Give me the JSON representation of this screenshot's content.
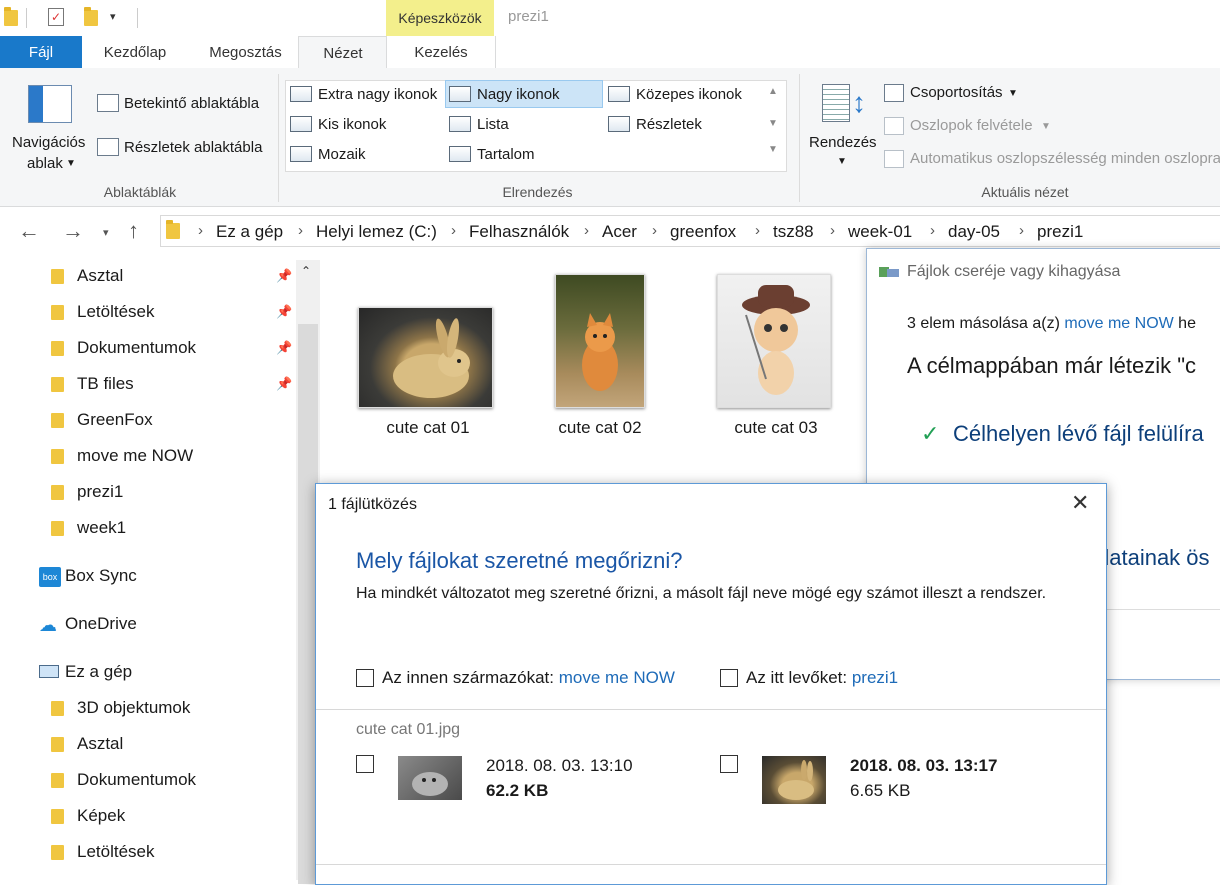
{
  "titlebar": {
    "context_tab": "Képeszközök",
    "window_title": "prezi1"
  },
  "ribbon_tabs": [
    "Fájl",
    "Kezdőlap",
    "Megosztás",
    "Nézet",
    "Kezelés"
  ],
  "panes": {
    "nav_pane_line1": "Navigációs",
    "nav_pane_line2": "ablak",
    "preview_pane": "Betekintő ablaktábla",
    "details_pane": "Részletek ablaktábla",
    "group_label": "Ablaktáblák"
  },
  "layout": {
    "items": [
      "Extra nagy ikonok",
      "Nagy ikonok",
      "Közepes ikonok",
      "Kis ikonok",
      "Lista",
      "Részletek",
      "Mozaik",
      "Tartalom"
    ],
    "selected": "Nagy ikonok",
    "group_label": "Elrendezés"
  },
  "current_view": {
    "sort": "Rendezés",
    "group_by": "Csoportosítás",
    "add_columns": "Oszlopok felvétele",
    "autosize": "Automatikus oszlopszélesség minden oszlopra",
    "group_label": "Aktuális nézet"
  },
  "breadcrumb": [
    "Ez a gép",
    "Helyi lemez (C:)",
    "Felhasználók",
    "Acer",
    "greenfox",
    "tsz88",
    "week-01",
    "day-05",
    "prezi1"
  ],
  "sidebar": {
    "quick_access": [
      {
        "label": "Asztal",
        "pinned": true
      },
      {
        "label": "Letöltések",
        "pinned": true
      },
      {
        "label": "Dokumentumok",
        "pinned": true
      },
      {
        "label": "TB files",
        "pinned": true
      },
      {
        "label": "GreenFox",
        "pinned": false
      },
      {
        "label": "move me NOW",
        "pinned": false
      },
      {
        "label": "prezi1",
        "pinned": false
      },
      {
        "label": "week1",
        "pinned": false
      }
    ],
    "box_sync": "Box Sync",
    "onedrive": "OneDrive",
    "this_pc": "Ez a gép",
    "pc_items": [
      "3D objektumok",
      "Asztal",
      "Dokumentumok",
      "Képek",
      "Letöltések"
    ]
  },
  "files": [
    "cute cat 01",
    "cute cat 02",
    "cute cat 03"
  ],
  "progress_dialog": {
    "title": "Fájlok cseréje vagy kihagyása",
    "copy_prefix": "3 elem másolása a(z) ",
    "copy_source": "move me NOW",
    "copy_suffix": " he",
    "exists_text": "A célmappában már létezik \"c",
    "replace_option": "Célhelyen lévő fájl felülíra",
    "compare_partial": "datainak ös"
  },
  "conflict_dialog": {
    "title": "1 fájlütközés",
    "heading": "Mely fájlokat szeretné megőrizni?",
    "description": "Ha mindkét változatot meg szeretné őrizni, a másolt fájl neve mögé egy számot illeszt a rendszer.",
    "from_label": "Az innen származókat: ",
    "from_link": "move me NOW",
    "here_label": "Az itt levőket: ",
    "here_link": "prezi1",
    "file_name": "cute cat 01.jpg",
    "source_date": "2018. 08. 03. 13:10",
    "source_size": "62.2 KB",
    "dest_date": "2018. 08. 03. 13:17",
    "dest_size": "6.65 KB"
  }
}
